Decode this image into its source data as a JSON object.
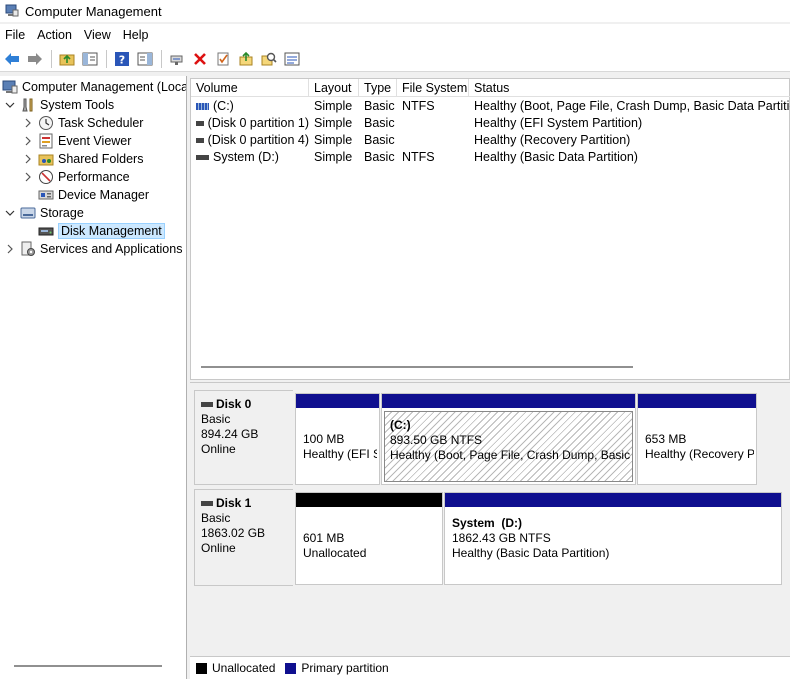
{
  "window": {
    "title": "Computer Management"
  },
  "menu": [
    "File",
    "Action",
    "View",
    "Help"
  ],
  "toolbar": {
    "buttons": [
      "back-icon",
      "forward-icon",
      "up-folder-icon",
      "show-hide-tree-icon",
      "help-icon",
      "show-hide-action-pane-icon",
      "connect-icon",
      "delete-icon",
      "properties-icon",
      "export-icon",
      "search-icon",
      "list-icon"
    ]
  },
  "tree": {
    "root": "Computer Management (Local",
    "system_tools": "System Tools",
    "task_scheduler": "Task Scheduler",
    "event_viewer": "Event Viewer",
    "shared_folders": "Shared Folders",
    "performance": "Performance",
    "device_manager": "Device Manager",
    "storage": "Storage",
    "disk_management": "Disk Management",
    "services": "Services and Applications"
  },
  "volumes": {
    "headers": [
      "Volume",
      "Layout",
      "Type",
      "File System",
      "Status"
    ],
    "rows": [
      [
        "(C:)",
        "Simple",
        "Basic",
        "NTFS",
        "Healthy (Boot, Page File, Crash Dump, Basic Data Partition)"
      ],
      [
        "(Disk 0 partition 1)",
        "Simple",
        "Basic",
        "",
        "Healthy (EFI System Partition)"
      ],
      [
        "(Disk 0 partition 4)",
        "Simple",
        "Basic",
        "",
        "Healthy (Recovery Partition)"
      ],
      [
        "System (D:)",
        "Simple",
        "Basic",
        "NTFS",
        "Healthy (Basic Data Partition)"
      ]
    ]
  },
  "disks": {
    "disk0": {
      "name": "Disk 0",
      "type": "Basic",
      "size": "894.24 GB",
      "status": "Online",
      "p1": {
        "size": "100 MB",
        "status": "Healthy (EFI S"
      },
      "p2": {
        "name": "(C:)",
        "size": "893.50 GB NTFS",
        "status": "Healthy (Boot, Page File, Crash Dump, Basic D"
      },
      "p3": {
        "size": "653 MB",
        "status": "Healthy (Recovery P"
      }
    },
    "disk1": {
      "name": "Disk 1",
      "type": "Basic",
      "size": "1863.02 GB",
      "status": "Online",
      "p1": {
        "size": "601 MB",
        "status": "Unallocated"
      },
      "p2": {
        "name": "System  (D:)",
        "size": "1862.43 GB NTFS",
        "status": "Healthy (Basic Data Partition)"
      }
    }
  },
  "legend": {
    "unallocated": "Unallocated",
    "primary": "Primary partition"
  },
  "colors": {
    "primary": "#0f0f8f",
    "unallocated": "#000000",
    "selection": "#cce8ff"
  }
}
